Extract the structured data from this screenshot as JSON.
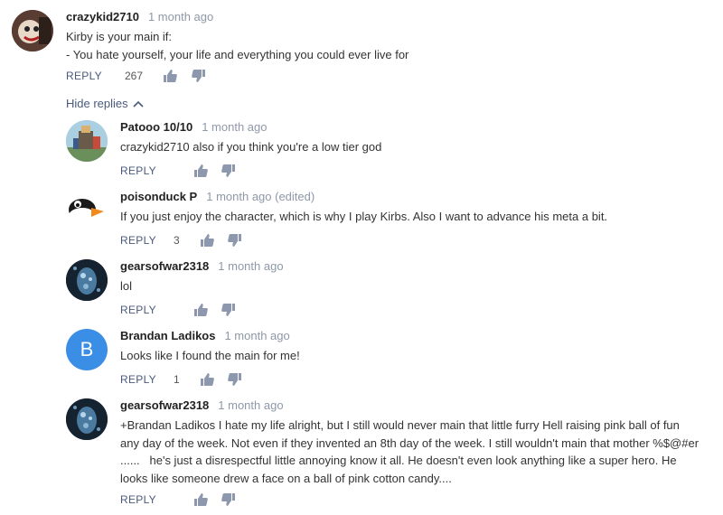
{
  "main_comment": {
    "author": "crazykid2710",
    "time": "1 month ago",
    "lines": [
      "Kirby is your main if:",
      "- You hate yourself, your life and everything you could ever live for"
    ],
    "reply_label": "REPLY",
    "likes": "267"
  },
  "hide_replies_label": "Hide replies",
  "replies": [
    {
      "author": "Patooo 10/10",
      "time": "1 month ago",
      "lines": [
        "crazykid2710 also if you think you're a low tier god"
      ],
      "reply_label": "REPLY",
      "likes": ""
    },
    {
      "author": "poisonduck P",
      "time": "1 month ago (edited)",
      "lines": [
        "If you just enjoy the character, which is why I play Kirbs. Also I want to advance his meta a bit."
      ],
      "reply_label": "REPLY",
      "likes": "3"
    },
    {
      "author": "gearsofwar2318",
      "time": "1 month ago",
      "lines": [
        "lol"
      ],
      "reply_label": "REPLY",
      "likes": ""
    },
    {
      "author": "Brandan Ladikos",
      "time": "1 month ago",
      "avatar_letter": "B",
      "lines": [
        "Looks like I found the main for me!"
      ],
      "reply_label": "REPLY",
      "likes": "1"
    },
    {
      "author": "gearsofwar2318",
      "time": "1 month ago",
      "lines": [
        "+Brandan Ladikos I hate my life alright, but I still would never main that little furry Hell raising pink ball of fun",
        "any day of the week. Not even if they invented an 8th day of the week. I still wouldn't main that mother %$@#er",
        "......   he's just a disrespectful little annoying know it all. He doesn't even look anything like a super hero. He",
        "looks like someone drew a face on a ball of pink cotton candy...."
      ],
      "reply_label": "REPLY",
      "likes": ""
    }
  ],
  "colors": {
    "action_link": "#4a5a7c",
    "timestamp": "#8f98a8",
    "letter_avatar": "#3b8ee6"
  }
}
